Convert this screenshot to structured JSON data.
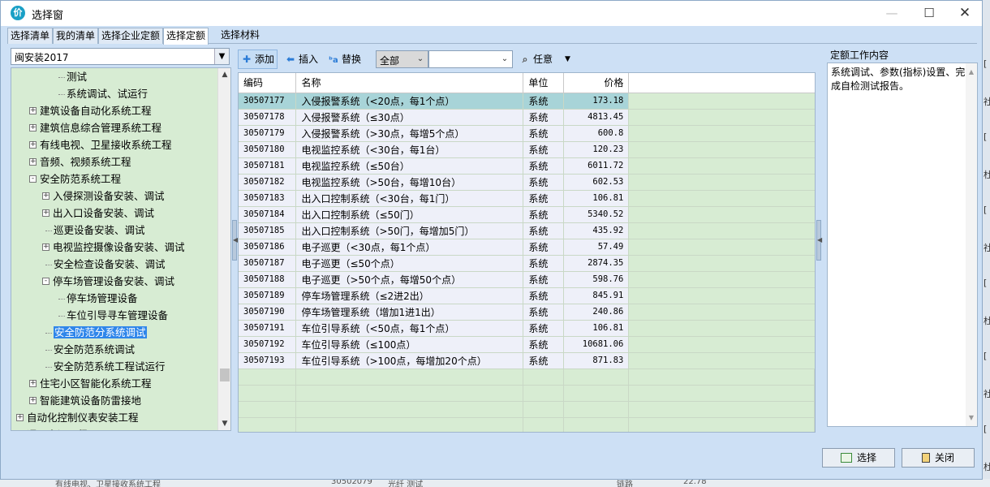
{
  "window": {
    "app_icon": "价",
    "title": "选择窗"
  },
  "tabs": [
    "选择清单",
    "我的清单",
    "选择企业定额",
    "选择定额",
    "选择材料"
  ],
  "project": {
    "selected": "闽安装2017"
  },
  "tree": [
    {
      "label": "测试"
    },
    {
      "label": "系统调试、试运行"
    },
    {
      "label": "建筑设备自动化系统工程"
    },
    {
      "label": "建筑信息综合管理系统工程"
    },
    {
      "label": "有线电视、卫星接收系统工程"
    },
    {
      "label": "音频、视频系统工程"
    },
    {
      "label": "安全防范系统工程"
    },
    {
      "label": "入侵探测设备安装、调试"
    },
    {
      "label": "出入口设备安装、调试"
    },
    {
      "label": "巡更设备安装、调试"
    },
    {
      "label": "电视监控摄像设备安装、调试"
    },
    {
      "label": "安全检查设备安装、调试"
    },
    {
      "label": "停车场管理设备安装、调试"
    },
    {
      "label": "停车场管理设备"
    },
    {
      "label": "车位引导寻车管理设备"
    },
    {
      "label": "安全防范分系统调试"
    },
    {
      "label": "安全防范系统调试"
    },
    {
      "label": "安全防范系统工程试运行"
    },
    {
      "label": "住宅小区智能化系统工程"
    },
    {
      "label": "智能建筑设备防雷接地"
    },
    {
      "label": "自动化控制仪表安装工程"
    },
    {
      "label": "通风空调工程"
    }
  ],
  "toolbar": {
    "add": "添加",
    "insert": "插入",
    "replace": "替换",
    "filter_value": "全部",
    "search_value": "",
    "any": "任意"
  },
  "grid": {
    "headers": {
      "code": "编码",
      "name": "名称",
      "unit": "单位",
      "price": "价格"
    },
    "rows": [
      {
        "code": "30507177",
        "name": "入侵报警系统（<20点，每1个点）",
        "unit": "系统",
        "price": "173.18"
      },
      {
        "code": "30507178",
        "name": "入侵报警系统（≤30点）",
        "unit": "系统",
        "price": "4813.45"
      },
      {
        "code": "30507179",
        "name": "入侵报警系统（>30点，每增5个点）",
        "unit": "系统",
        "price": "600.8"
      },
      {
        "code": "30507180",
        "name": "电视监控系统（<30台，每1台）",
        "unit": "系统",
        "price": "120.23"
      },
      {
        "code": "30507181",
        "name": "电视监控系统（≤50台）",
        "unit": "系统",
        "price": "6011.72"
      },
      {
        "code": "30507182",
        "name": "电视监控系统（>50台，每增10台）",
        "unit": "系统",
        "price": "602.53"
      },
      {
        "code": "30507183",
        "name": "出入口控制系统（<30台，每1门）",
        "unit": "系统",
        "price": "106.81"
      },
      {
        "code": "30507184",
        "name": "出入口控制系统（≤50门）",
        "unit": "系统",
        "price": "5340.52"
      },
      {
        "code": "30507185",
        "name": "出入口控制系统（>50门，每增加5门）",
        "unit": "系统",
        "price": "435.92"
      },
      {
        "code": "30507186",
        "name": "电子巡更（<30点，每1个点）",
        "unit": "系统",
        "price": "57.49"
      },
      {
        "code": "30507187",
        "name": "电子巡更（≤50个点）",
        "unit": "系统",
        "price": "2874.35"
      },
      {
        "code": "30507188",
        "name": "电子巡更（>50个点，每增50个点）",
        "unit": "系统",
        "price": "598.76"
      },
      {
        "code": "30507189",
        "name": "停车场管理系统（≤2进2出）",
        "unit": "系统",
        "price": "845.91"
      },
      {
        "code": "30507190",
        "name": "停车场管理系统（增加1进1出）",
        "unit": "系统",
        "price": "240.86"
      },
      {
        "code": "30507191",
        "name": "车位引导系统（<50点，每1个点）",
        "unit": "系统",
        "price": "106.81"
      },
      {
        "code": "30507192",
        "name": "车位引导系统（≤100点）",
        "unit": "系统",
        "price": "10681.06"
      },
      {
        "code": "30507193",
        "name": "车位引导系统（>100点，每增加20个点）",
        "unit": "系统",
        "price": "871.83"
      }
    ]
  },
  "work_content": {
    "title": "定额工作内容",
    "text": "系统调试、参数(指标)设置、完成自检测试报告。"
  },
  "buttons": {
    "select": "选择",
    "close": "关闭"
  },
  "background": {
    "right_marks": [
      "[",
      "社",
      "[",
      "杜",
      "[",
      "社",
      "[",
      "杜",
      "[",
      "社",
      "[",
      "杜"
    ],
    "bottom_tree": "有线电视、卫星接收系统工程",
    "bottom_code": "30502079",
    "bottom_name": "光纤 测试",
    "bottom_unit": "链路",
    "bottom_price": "22.78"
  },
  "colors": {
    "tree_bg": "#d7ecd3",
    "selected_row": "#a8d4d8",
    "selected_tree": "#2f86ea"
  }
}
